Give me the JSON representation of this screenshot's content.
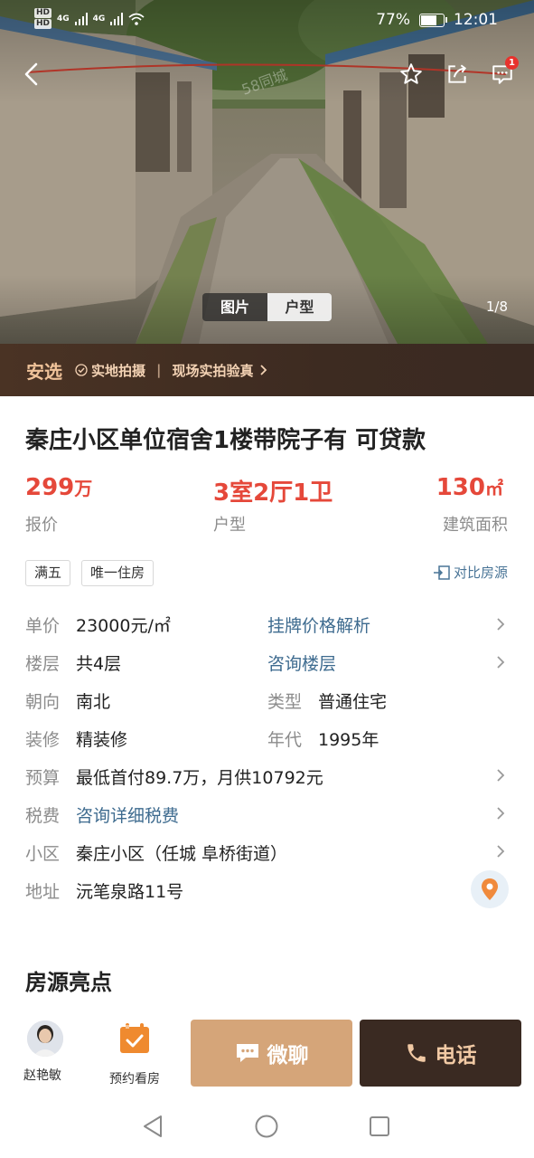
{
  "status_bar": {
    "hd1": "HD",
    "hd2": "HD",
    "net1": "4G",
    "net2": "4G",
    "battery": "77%",
    "battery_level": 0.77,
    "time": "12:01"
  },
  "hero": {
    "watermark": "58同城",
    "tabs": [
      "图片",
      "户型"
    ],
    "active_tab": "图片",
    "counter": "1/8",
    "message_badge": "1"
  },
  "anxuan": {
    "brand": "安选",
    "feature1": "实地拍摄",
    "separator": "|",
    "feature2": "现场实拍验真"
  },
  "listing": {
    "title": "秦庄小区单位宿舍1楼带院子有  可贷款",
    "price_value": "299",
    "price_unit": "万",
    "price_label": "报价",
    "layout_value": "3室2厅1卫",
    "layout_label": "户型",
    "area_value": "130",
    "area_unit": "㎡",
    "area_label": "建筑面积",
    "tags": [
      "满五",
      "唯一住房"
    ],
    "compare": "对比房源"
  },
  "details": {
    "unit_price_label": "单价",
    "unit_price": "23000元/㎡",
    "price_analysis": "挂牌价格解析",
    "floor_label": "楼层",
    "floor": "共4层",
    "floor_consult": "咨询楼层",
    "orientation_label": "朝向",
    "orientation": "南北",
    "type_label": "类型",
    "type": "普通住宅",
    "decoration_label": "装修",
    "decoration": "精装修",
    "year_label": "年代",
    "year": "1995年",
    "budget_label": "预算",
    "budget": "最低首付89.7万，月供10792元",
    "tax_label": "税费",
    "tax": "咨询详细税费",
    "community_label": "小区",
    "community": "秦庄小区（任城 阜桥街道）",
    "address_label": "地址",
    "address": "沅笔泉路11号"
  },
  "highlights_title": "房源亮点",
  "bottom": {
    "agent_name": "赵艳敏",
    "schedule": "预约看房",
    "chat": "微聊",
    "call": "电话"
  },
  "colors": {
    "accent_red": "#e5483a",
    "link_blue": "#3e6b8f",
    "chat_button": "#d5a579",
    "call_button": "#3a2a22",
    "anxuan_bg": "#3d2b21",
    "calendar_icon": "#ef8a2f"
  }
}
